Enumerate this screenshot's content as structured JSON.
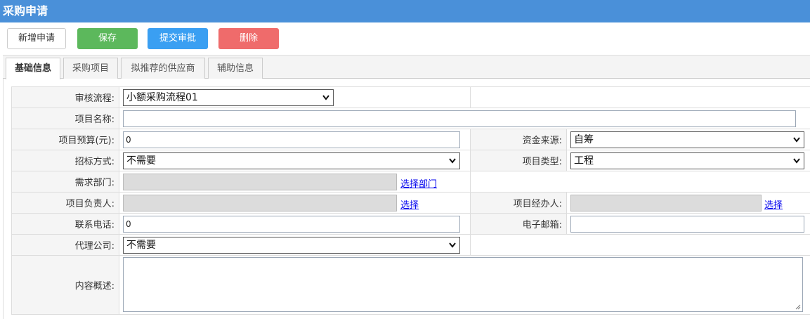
{
  "window": {
    "title": "采购申请"
  },
  "toolbar": {
    "new_label": "新增申请",
    "save_label": "保存",
    "submit_label": "提交审批",
    "delete_label": "删除"
  },
  "tabs": [
    {
      "label": "基础信息",
      "active": true
    },
    {
      "label": "采购项目",
      "active": false
    },
    {
      "label": "拟推荐的供应商",
      "active": false
    },
    {
      "label": "辅助信息",
      "active": false
    }
  ],
  "form": {
    "workflow": {
      "label": "审核流程:",
      "value": "小额采购流程01"
    },
    "project_name": {
      "label": "项目名称:",
      "value": ""
    },
    "budget": {
      "label": "项目预算(元):",
      "value": "0"
    },
    "fund_source": {
      "label": "资金来源:",
      "value": "自筹"
    },
    "bidding_method": {
      "label": "招标方式:",
      "value": "不需要"
    },
    "project_type": {
      "label": "项目类型:",
      "value": "工程"
    },
    "department": {
      "label": "需求部门:",
      "value": "",
      "link": "选择部门"
    },
    "project_lead": {
      "label": "项目负责人:",
      "value": "",
      "link": "选择"
    },
    "project_handler": {
      "label": "项目经办人:",
      "value": "",
      "link": "选择"
    },
    "phone": {
      "label": "联系电话:",
      "value": "0"
    },
    "email": {
      "label": "电子邮箱:",
      "value": ""
    },
    "agency": {
      "label": "代理公司:",
      "value": "不需要"
    },
    "summary": {
      "label": "内容概述:",
      "value": ""
    }
  },
  "colors": {
    "title_bar": "#4a90d9",
    "save": "#5cb85c",
    "submit": "#3a9ff2",
    "delete": "#ef6b6b"
  },
  "icons": {
    "select_arrow": "chevron-down-icon",
    "resize": "resize-grip-icon"
  }
}
